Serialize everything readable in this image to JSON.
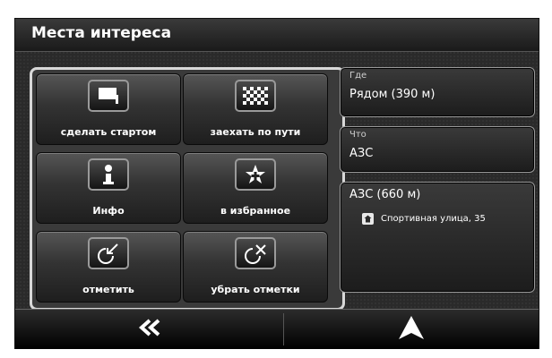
{
  "header": {
    "title": "Места интереса"
  },
  "actions": [
    {
      "label": "сделать стартом",
      "icon": "start-flag-icon"
    },
    {
      "label": "заехать по пути",
      "icon": "checkered-flag-icon"
    },
    {
      "label": "Инфо",
      "icon": "info-icon"
    },
    {
      "label": "в избранное",
      "icon": "favorite-star-icon"
    },
    {
      "label": "отметить",
      "icon": "mark-icon"
    },
    {
      "label": "убрать отметки",
      "icon": "clear-marks-icon"
    }
  ],
  "where": {
    "caption": "Где",
    "value": "Рядом (390 м)"
  },
  "what": {
    "caption": "Что",
    "value": "АЗС"
  },
  "result": {
    "title": "АЗС (660 м)",
    "address": "Спортивная улица, 35",
    "icon": "house-icon"
  },
  "bottom": {
    "back_icon": "double-chevron-left-icon",
    "nav_icon": "navigation-arrow-icon"
  },
  "colors": {
    "background": "#2a2a2a",
    "text": "#ffffff",
    "border": "#d8d8d8"
  }
}
